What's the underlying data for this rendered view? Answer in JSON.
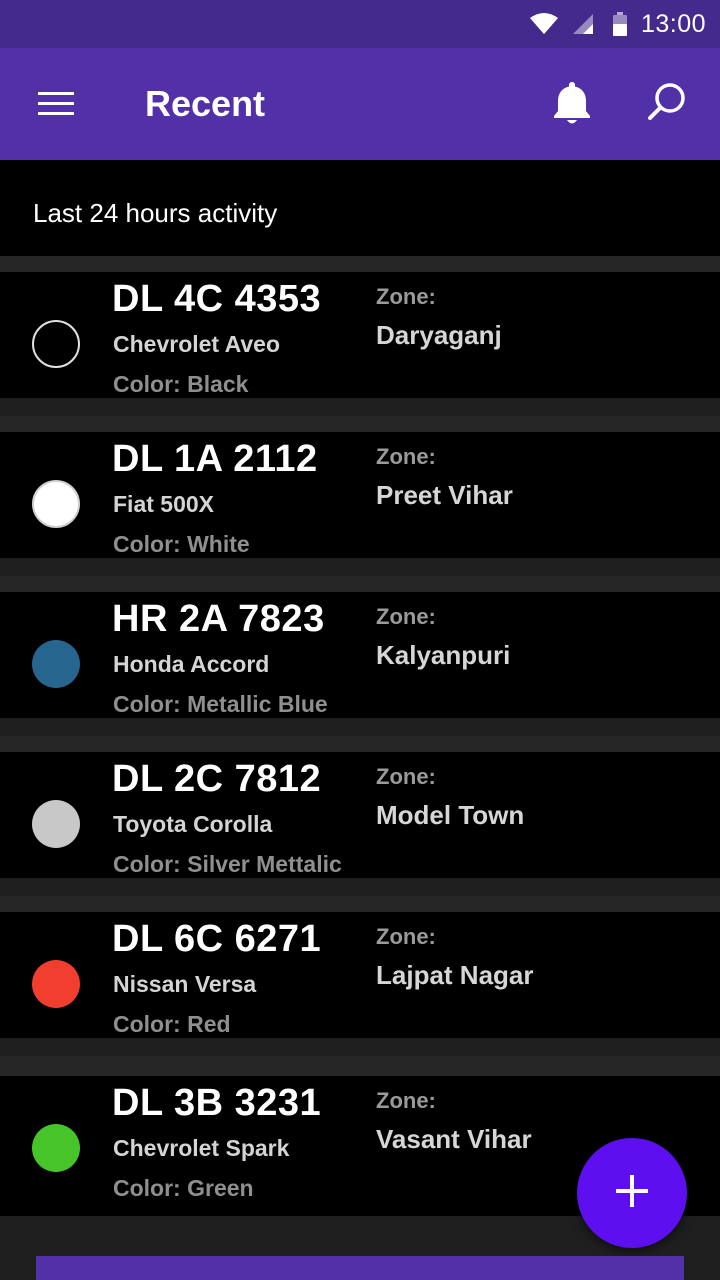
{
  "status_bar": {
    "time": "13:00",
    "icons": [
      "wifi-icon",
      "cellular-signal-icon",
      "battery-icon"
    ]
  },
  "app_bar": {
    "title": "Recent",
    "icons": [
      "menu-icon",
      "bell-icon",
      "search-icon"
    ]
  },
  "subheader": {
    "text": "Last 24 hours activity"
  },
  "vehicles": [
    {
      "plate": "DL 4C 4353",
      "model": "Chevrolet Aveo",
      "color_text": "Color: Black",
      "zone_label": "Zone:",
      "zone": "Daryaganj",
      "swatch": "#000000"
    },
    {
      "plate": "DL 1A 2112",
      "model": "Fiat 500X",
      "color_text": "Color: White",
      "zone_label": "Zone:",
      "zone": "Preet Vihar",
      "swatch": "#ffffff"
    },
    {
      "plate": "HR 2A 7823",
      "model": "Honda Accord",
      "color_text": "Color: Metallic Blue",
      "zone_label": "Zone:",
      "zone": "Kalyanpuri",
      "swatch": "#26668e"
    },
    {
      "plate": "DL 2C 7812",
      "model": "Toyota Corolla",
      "color_text": "Color: Silver Mettalic",
      "zone_label": "Zone:",
      "zone": "Model Town",
      "swatch": "#c8c8c8"
    },
    {
      "plate": "DL 6C 6271",
      "model": "Nissan Versa",
      "color_text": "Color: Red",
      "zone_label": "Zone:",
      "zone": "Lajpat Nagar",
      "swatch": "#f23e2e"
    },
    {
      "plate": "DL 3B 3231",
      "model": "Chevrolet Spark",
      "color_text": "Color: Green",
      "zone_label": "Zone:",
      "zone": "Vasant Vihar",
      "swatch": "#47c42a"
    }
  ],
  "fab": {
    "icon": "plus-icon"
  },
  "theme": {
    "status_bar": "#442a8c",
    "app_bar": "#5130a8",
    "fab": "#5d0ff0",
    "background": "#000000"
  }
}
